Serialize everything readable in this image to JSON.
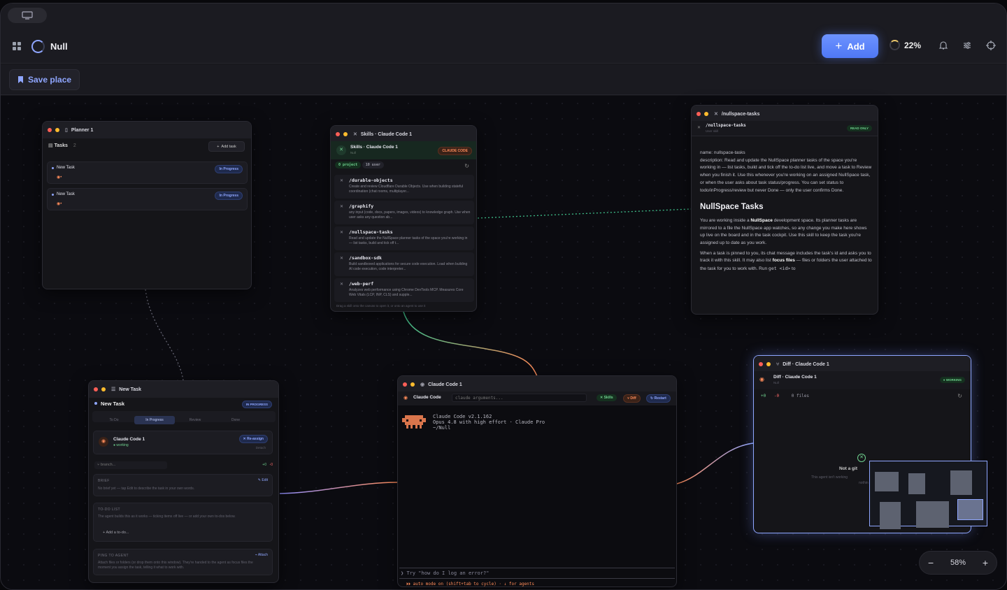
{
  "app": {
    "title": "Null"
  },
  "header": {
    "add_label": "Add",
    "progress_label": "22%"
  },
  "subbar": {
    "save_label": "Save place"
  },
  "planner": {
    "title": "Planner 1",
    "tasks_label": "Tasks",
    "tasks_count": "2",
    "add_task": "Add task",
    "tasks": [
      {
        "name": "New Task",
        "status": "In Progress"
      },
      {
        "name": "New Task",
        "status": "In Progress"
      }
    ]
  },
  "skills": {
    "title": "Skills · Claude Code 1",
    "subtitle": "Skills · Claude Code 1",
    "subtitle_small": "Null",
    "badge": "CLAUDE CODE",
    "project_label": "0 project",
    "user_label": "10 user",
    "items": [
      {
        "name": "/durable-objects",
        "desc": "Create and review Cloudflare Durable Objects. Use when building stateful coordination (chat rooms, multiplayer..."
      },
      {
        "name": "/graphify",
        "desc": "any input (code, docs, papers, images, videos) to knowledge graph. Use when user asks any question ab..."
      },
      {
        "name": "/nullspace-tasks",
        "desc": "Read and update the NullSpace planner tasks of the space you're working in — list tasks, build and tick off t..."
      },
      {
        "name": "/sandbox-sdk",
        "desc": "Build sandboxed applications for secure code execution. Load when building AI code execution, code interpreter..."
      },
      {
        "name": "/web-perf",
        "desc": "Analyzes web performance using Chrome DevTools MCP. Measures Core Web Vitals (LCP, INP, CLS) and supple..."
      }
    ],
    "footer": "Drag a skill onto the canvas to open it, or onto an agent to use it"
  },
  "doc": {
    "title": "/nullspace-tasks",
    "subtitle": "/nullspace-tasks",
    "subtitle_small": "User skill",
    "badge": "READ ONLY",
    "meta_name": "name: nullspace-tasks",
    "meta_desc": "description: Read and update the NullSpace planner tasks of the space you're working in — list tasks, build and tick off the to-do list live, and move a task to Review when you finish it. Use this whenever you're working on an assigned NullSpace task, or when the user asks about task status/progress. You can set status to todo/inProgress/review but never Done — only the user confirms Done.",
    "heading": "NullSpace Tasks",
    "para1_a": "You are working inside a ",
    "para1_b": "NullSpace",
    "para1_c": " development space. Its planner tasks are mirrored to a file the NullSpace app watches, so any change you make here shows up live on the board and in the task cockpit. Use this skill to keep the task you're assigned up to date as you work.",
    "para2_a": "When a task is pinned to you, its chat message includes the task's id and asks you to track it with this skill. It may also list ",
    "para2_b": "focus files",
    "para2_c": " — files or folders the user attached to the task for you to work with. Run ",
    "para2_code": "get <id>",
    "para2_d": " to"
  },
  "task": {
    "title": "New Task",
    "name": "New Task",
    "status_badge": "IN PROGRESS",
    "tabs": [
      "To Do",
      "In Progress",
      "Review",
      "Done"
    ],
    "agent_name": "Claude Code 1",
    "agent_status": "working",
    "reassign": "Re-assign",
    "detach": "Detach",
    "branch_placeholder": "branch...",
    "diff_add": "+0",
    "diff_del": "-0",
    "brief_label": "BRIEF",
    "edit_label": "Edit",
    "brief_text": "No brief yet — tap Edit to describe the task in your own words.",
    "todo_label": "TO-DO LIST",
    "todo_text": "The agent builds this as it works — ticking items off live — or add your own to-dos below.",
    "add_todo": "Add a to-do...",
    "ping_label": "PING TO AGENT",
    "attach_label": "Attach",
    "ping_text": "Attach files or folders (or drop them onto this window). They're handed to the agent as focus files the moment you assign the task, telling it what to work with."
  },
  "terminal": {
    "title": "Claude Code 1",
    "app_label": "Claude Code",
    "args_placeholder": "claude arguments...",
    "skills_btn": "Skills",
    "diff_btn": "Diff",
    "restart_btn": "Restart",
    "line1": "Claude Code v2.1.162",
    "line2": "Opus 4.8 with high effort · Claude Pro",
    "line3": "~/Null",
    "prompt": "Try \"how do I log an error?\"",
    "mode_line": "⏵⏵ auto mode on (shift+tab to cycle) · ↓ for agents"
  },
  "diff": {
    "title": "Diff · Claude Code 1",
    "subtitle": "Diff · Claude Code 1",
    "subtitle_small": "Null",
    "badge": "WORKING",
    "add": "+0",
    "del": "-0",
    "files": "0 files",
    "empty_title": "Not a git",
    "empty_text": "This agent isn't working",
    "empty_text2": "nothin"
  },
  "zoom": {
    "level": "58%",
    "minus": "−",
    "plus": "+"
  },
  "colors": {
    "accent": "#8fa6ff",
    "green": "#6fd18e",
    "orange": "#ff8c5a"
  }
}
